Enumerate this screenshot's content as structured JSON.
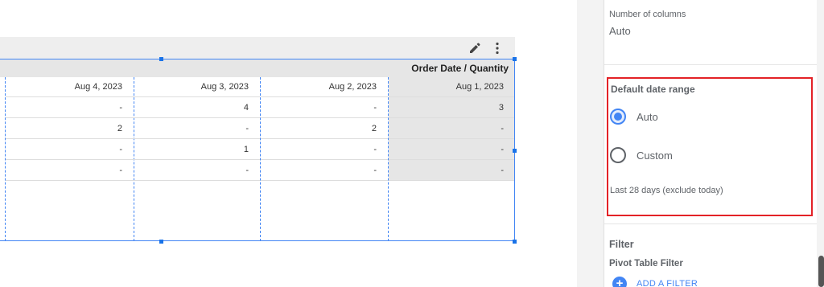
{
  "pivot_table": {
    "header_title": "Order Date / Quantity",
    "columns": [
      {
        "date": "Aug 4, 2023",
        "cells": [
          "-",
          "2",
          "-",
          "-"
        ]
      },
      {
        "date": "Aug 3, 2023",
        "cells": [
          "4",
          "-",
          "1",
          "-"
        ]
      },
      {
        "date": "Aug 2, 2023",
        "cells": [
          "-",
          "2",
          "-",
          "-"
        ]
      },
      {
        "date": "Aug 1, 2023",
        "cells": [
          "3",
          "-",
          "-",
          "-"
        ]
      }
    ]
  },
  "toolbar": {
    "edit_icon": "pencil-icon",
    "more_icon": "more-vert-icon"
  },
  "panel": {
    "num_columns_label": "Number of columns",
    "num_columns_value": "Auto",
    "date_range": {
      "title": "Default date range",
      "options": [
        {
          "label": "Auto",
          "checked": true
        },
        {
          "label": "Custom",
          "checked": false
        }
      ],
      "hint": "Last 28 days (exclude today)"
    },
    "filter_title": "Filter",
    "pivot_filter_title": "Pivot Table Filter",
    "add_filter_label": "ADD A FILTER",
    "add_filter_icon": "plus-icon"
  },
  "colors": {
    "accent": "#4285f4",
    "highlight_border": "#e32227",
    "header_bg": "#e6e6e6"
  }
}
